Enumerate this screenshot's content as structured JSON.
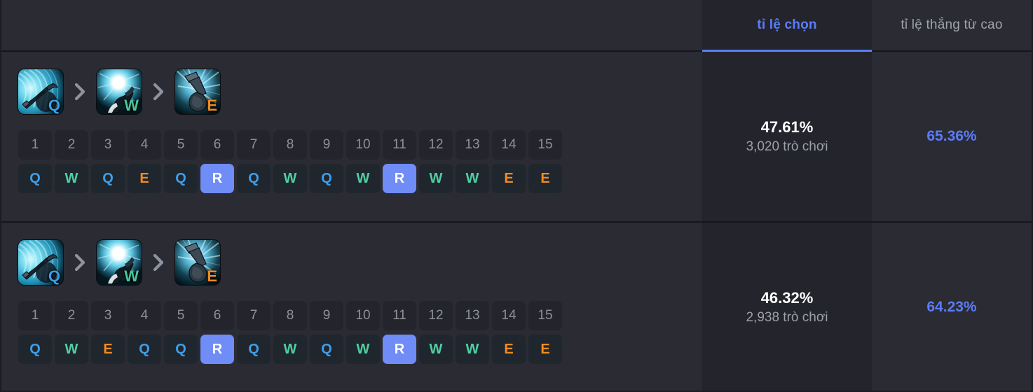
{
  "header": {
    "tabs": [
      {
        "label": "tỉ lệ chọn",
        "active": true
      },
      {
        "label": "tỉ lệ thắng từ cao",
        "active": false
      }
    ]
  },
  "colors": {
    "accent": "#5b7cfa",
    "q": "#3d9fe8",
    "w": "#4fd0a3",
    "e": "#f28c1e",
    "r_bg": "#6f8cf7",
    "background": "#2a2b33",
    "active_column": "#24252c"
  },
  "levels": [
    "1",
    "2",
    "3",
    "4",
    "5",
    "6",
    "7",
    "8",
    "9",
    "10",
    "11",
    "12",
    "13",
    "14",
    "15"
  ],
  "rows": [
    {
      "max_order": [
        {
          "key": "Q",
          "icon": "blade-wave-icon"
        },
        {
          "key": "W",
          "icon": "glow-orb-icon"
        },
        {
          "key": "E",
          "icon": "hammer-icon"
        }
      ],
      "separator": "chevron-right-icon",
      "skill_order": [
        "Q",
        "W",
        "Q",
        "E",
        "Q",
        "R",
        "Q",
        "W",
        "Q",
        "W",
        "R",
        "W",
        "W",
        "E",
        "E"
      ],
      "pick_rate": "47.61%",
      "games": "3,020 trò chơi",
      "win_rate": "65.36%"
    },
    {
      "max_order": [
        {
          "key": "Q",
          "icon": "blade-wave-icon"
        },
        {
          "key": "W",
          "icon": "glow-orb-icon"
        },
        {
          "key": "E",
          "icon": "hammer-icon"
        }
      ],
      "separator": "chevron-right-icon",
      "skill_order": [
        "Q",
        "W",
        "E",
        "Q",
        "Q",
        "R",
        "Q",
        "W",
        "Q",
        "W",
        "R",
        "W",
        "W",
        "E",
        "E"
      ],
      "pick_rate": "46.32%",
      "games": "2,938 trò chơi",
      "win_rate": "64.23%"
    }
  ]
}
